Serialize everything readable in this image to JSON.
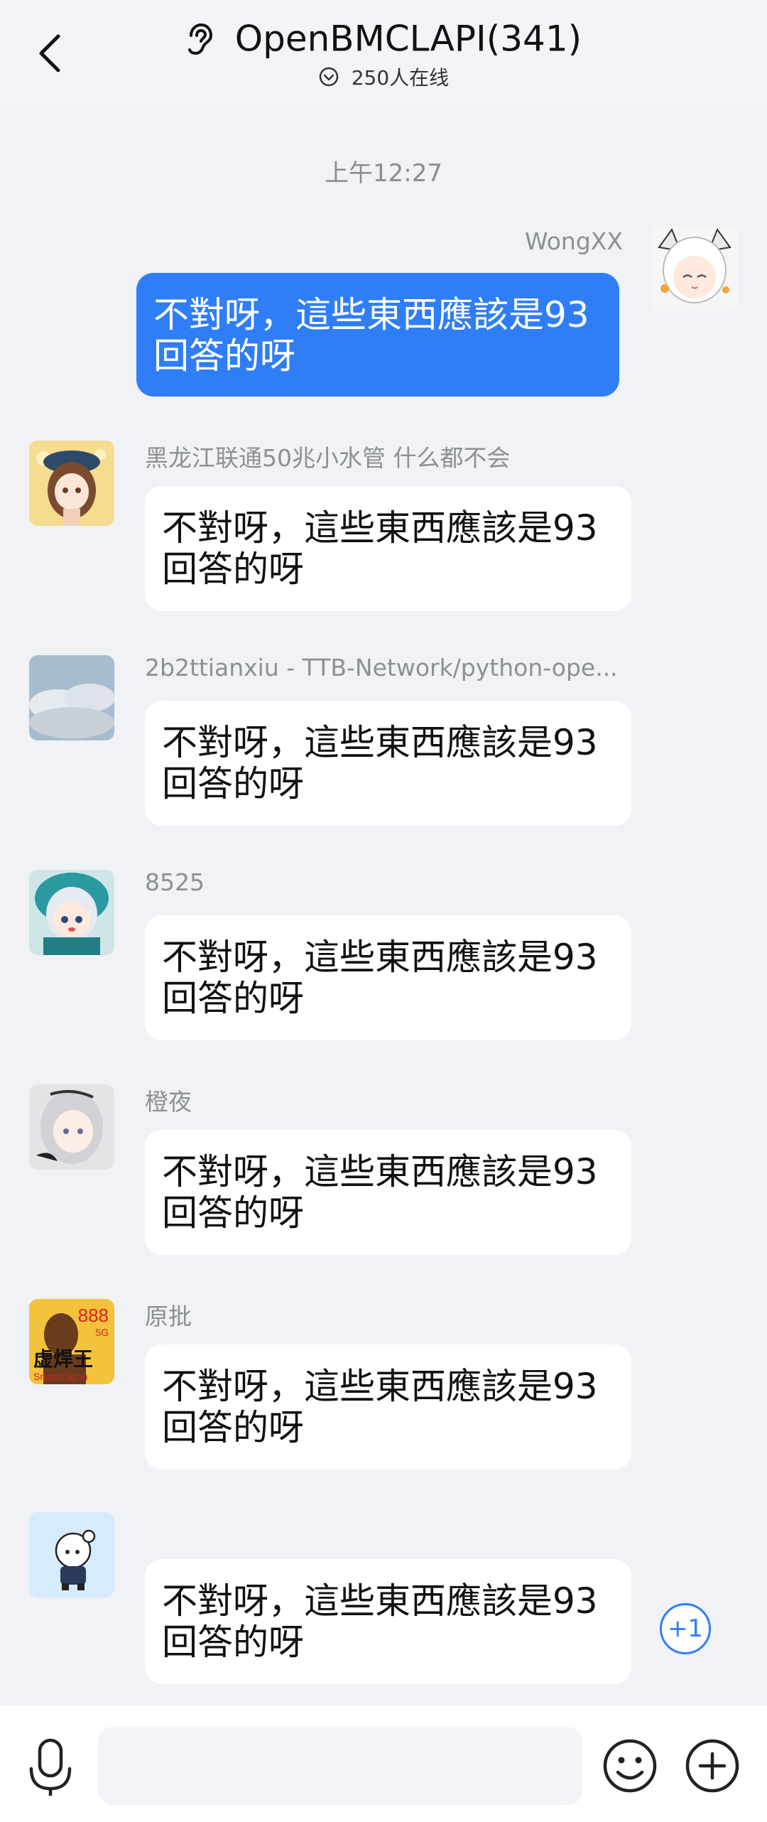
{
  "header": {
    "title": "OpenBMCLAPI(341)",
    "online": "250人在线"
  },
  "time_divider": "上午12:27",
  "messages": [
    {
      "sender": "WongXX",
      "line1": "不對呀，這些東西應該是93",
      "line2": "回答的呀",
      "own": true
    },
    {
      "sender": "黑龙江联通50兆小水管 什么都不会",
      "line1": "不對呀，這些東西應該是93",
      "line2": "回答的呀"
    },
    {
      "sender": "2b2ttianxiu - TTB-Network/python-ope...",
      "line1": "不對呀，這些東西應該是93",
      "line2": "回答的呀"
    },
    {
      "sender": "8525",
      "line1": "不對呀，這些東西應該是93",
      "line2": "回答的呀"
    },
    {
      "sender": "橙夜",
      "line1": "不對呀，這些東西應該是93",
      "line2": "回答的呀"
    },
    {
      "sender": "原批",
      "line1": "不對呀，這些東西應該是93",
      "line2": "回答的呀"
    },
    {
      "sender": "",
      "line1": "不對呀，這些東西應該是93",
      "line2": "回答的呀"
    }
  ],
  "avatar_badge": {
    "text_top": "888",
    "text_mid": "虚焊王",
    "text_small": "5G",
    "text_bottom": "Snapdragon"
  },
  "plus_one": "+1",
  "input": {
    "placeholder": ""
  },
  "colors": {
    "accent": "#2f7ef7",
    "background": "#f1f2f6",
    "bubble_in": "#ffffff"
  }
}
